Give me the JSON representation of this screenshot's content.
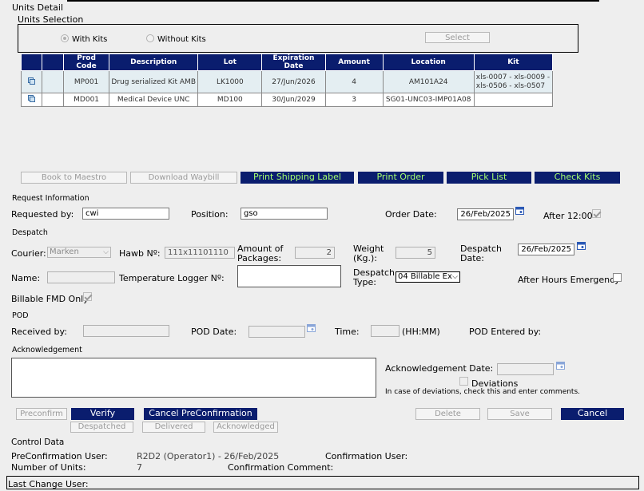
{
  "page": {
    "title": "Units Detail",
    "units_selection_label": "Units Selection",
    "with_kits_label": "With Kits",
    "without_kits_label": "Without Kits",
    "select_button": "Select"
  },
  "table": {
    "headers": [
      "",
      "",
      "Prod Code",
      "Description",
      "Lot",
      "Expiration Date",
      "Amount",
      "Location",
      "Kit"
    ],
    "rows": [
      {
        "prod_code": "MP001",
        "description": "Drug serialized Kit AMB",
        "lot": "LK1000",
        "expiration": "27/Jun/2026",
        "amount": "4",
        "location": "AM101A24",
        "kit_line1": "xls-0007 - xls-0009 -",
        "kit_line2": "xls-0506 - xls-0507"
      },
      {
        "prod_code": "MD001",
        "description": "Medical Device UNC",
        "lot": "MD100",
        "expiration": "30/Jun/2029",
        "amount": "3",
        "location": "SG01-UNC03-IMP01A08",
        "kit_line1": "",
        "kit_line2": ""
      }
    ]
  },
  "actions": {
    "book_to_maestro": "Book to Maestro",
    "download_waybill": "Download Waybill",
    "print_shipping_label": "Print Shipping Label",
    "print_order": "Print Order",
    "pick_list": "Pick List",
    "check_kits": "Check Kits"
  },
  "request": {
    "section": "Request Information",
    "requested_by_label": "Requested by:",
    "requested_by": "cwi",
    "position_label": "Position:",
    "position": "gso",
    "order_date_label": "Order Date:",
    "order_date": "26/Feb/2025",
    "after_12_label": "After 12:00"
  },
  "despatch": {
    "section": "Despatch",
    "courier_label": "Courier:",
    "courier": "Marken",
    "hawb_label": "Hawb Nº:",
    "hawb": "111x11101110",
    "amount_packages_label_1": "Amount of",
    "amount_packages_label_2": "Packages:",
    "amount_packages": "2",
    "weight_label_1": "Weight",
    "weight_label_2": "(Kg.):",
    "weight": "5",
    "despatch_date_label_1": "Despatch",
    "despatch_date_label_2": "Date:",
    "despatch_date": "26/Feb/2025",
    "name_label": "Name:",
    "temp_logger_label": "Temperature Logger Nº:",
    "despatch_type_label_1": "Despatch",
    "despatch_type_label_2": "Type:",
    "despatch_type": "04 Billable Ex",
    "after_hours_label": "After Hours Emergency",
    "billable_fmd_label": "Billable FMD Only"
  },
  "pod": {
    "section": "POD",
    "received_by_label": "Received by:",
    "pod_date_label": "POD Date:",
    "time_label": "Time:",
    "time_hint": "(HH:MM)",
    "entered_by_label": "POD Entered by:"
  },
  "ack": {
    "section": "Acknowledgement",
    "date_label": "Acknowledgement Date:",
    "deviations_label": "Deviations",
    "deviations_hint": "In case of deviations, check this and enter comments."
  },
  "buttons": {
    "preconfirm": "Preconfirm",
    "verify": "Verify",
    "cancel_preconfirmation": "Cancel PreConfirmation",
    "delete": "Delete",
    "save": "Save",
    "cancel": "Cancel",
    "despatched": "Despatched",
    "delivered": "Delivered",
    "acknowledged": "Acknowledged"
  },
  "control": {
    "section": "Control Data",
    "preconfirmation_user_label": "PreConfirmation User:",
    "preconfirmation_user": "R2D2 (Operator1) - 26/Feb/2025",
    "confirmation_user_label": "Confirmation User:",
    "number_units_label": "Number of Units:",
    "number_units": "7",
    "confirmation_comment_label": "Confirmation Comment:",
    "last_change_user_label": "Last Change User:"
  }
}
